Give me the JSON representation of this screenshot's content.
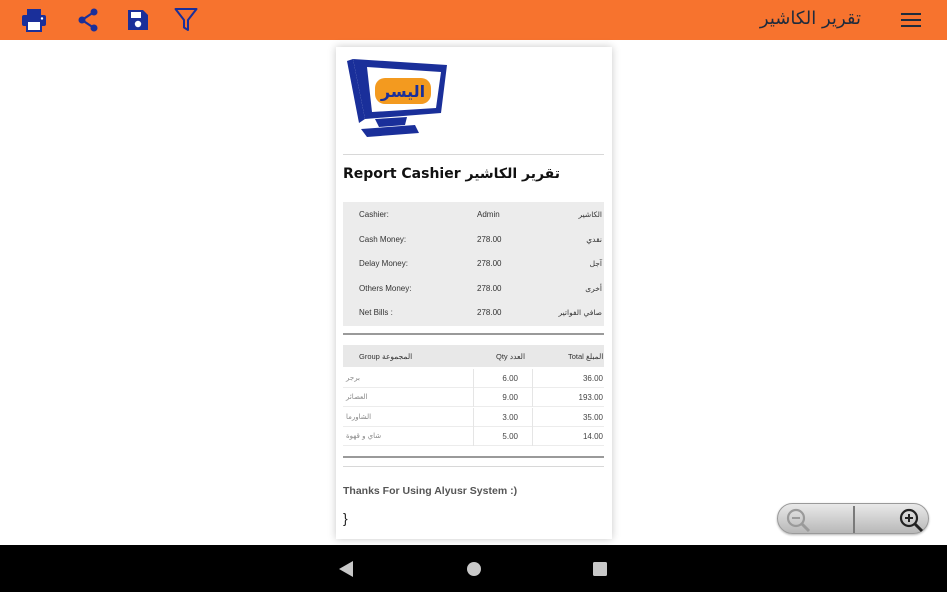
{
  "header": {
    "title": "تقرير الكاشير",
    "icons": [
      "print-icon",
      "share-icon",
      "save-icon",
      "filter-icon",
      "menu-icon"
    ]
  },
  "report": {
    "logo_text": "اليسر",
    "title": "Report Cashier تقرير الكاشير",
    "summary": [
      {
        "label_en": "Cashier:",
        "value": "Admin",
        "label_ar": "الكاشير"
      },
      {
        "label_en": "Cash Money:",
        "value": "278.00",
        "label_ar": "نقدي"
      },
      {
        "label_en": "Delay Money:",
        "value": "278.00",
        "label_ar": "آجل"
      },
      {
        "label_en": "Others Money:",
        "value": "278.00",
        "label_ar": "أخرى"
      },
      {
        "label_en": "Net Bills :",
        "value": "278.00",
        "label_ar": "صافي الفواتير"
      }
    ],
    "groups_header": {
      "group": "Group المجموعة",
      "qty": "Qty العدد",
      "total": "Total المبلغ"
    },
    "groups": [
      {
        "name": "برجر",
        "qty": "6.00",
        "total": "36.00"
      },
      {
        "name": "العصائر",
        "qty": "9.00",
        "total": "193.00"
      },
      {
        "name": "الشاورما",
        "qty": "3.00",
        "total": "35.00"
      },
      {
        "name": "شاي و قهوة",
        "qty": "5.00",
        "total": "14.00"
      }
    ],
    "thanks": "Thanks For Using Alyusr System :)",
    "brace": "}"
  },
  "zoom": {
    "icons": [
      "zoom-out-icon",
      "zoom-in-icon"
    ]
  },
  "nav": {
    "icons": [
      "back-icon",
      "home-icon",
      "recents-icon"
    ]
  },
  "colors": {
    "accent": "#f7732e",
    "logo_blue": "#1a2f9a",
    "logo_orange": "#f39a1f"
  }
}
